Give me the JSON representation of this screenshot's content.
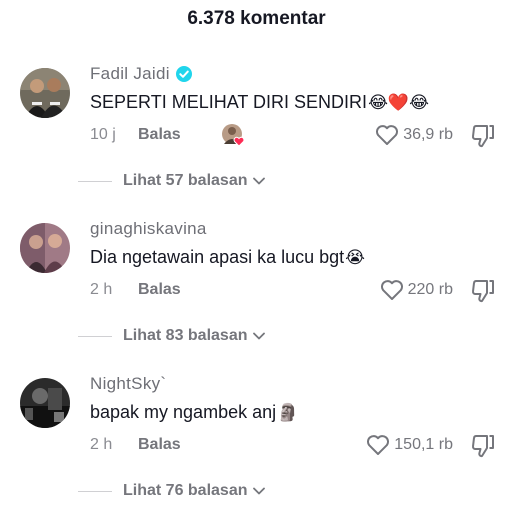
{
  "header": {
    "title": "6.378 komentar"
  },
  "comments": [
    {
      "username": "Fadil Jaidi",
      "verified": true,
      "text": "SEPERTI MELIHAT DIRI SENDIRI",
      "emoji": "😂❤️😂",
      "time": "10 j",
      "reply_label": "Balas",
      "creator_liked": true,
      "likes": "36,9 rb",
      "view_replies": "Lihat 57 balasan"
    },
    {
      "username": "ginaghiskavina",
      "verified": false,
      "text": "Dia ngetawain apasi ka lucu bgt",
      "emoji": "😭",
      "time": "2 h",
      "reply_label": "Balas",
      "creator_liked": false,
      "likes": "220 rb",
      "view_replies": "Lihat 83 balasan"
    },
    {
      "username": "NightSky`",
      "verified": false,
      "text": "bapak my ngambek anj",
      "emoji": "🗿",
      "time": "2 h",
      "reply_label": "Balas",
      "creator_liked": false,
      "likes": "150,1 rb",
      "view_replies": "Lihat 76 balasan"
    }
  ],
  "icons": {
    "like": "heart-outline-icon",
    "dislike": "thumbs-down-icon",
    "verified": "verified-badge-icon",
    "expand": "chevron-down-icon"
  },
  "colors": {
    "verified": "#20d5ec",
    "creator_heart": "#fe2c55"
  }
}
